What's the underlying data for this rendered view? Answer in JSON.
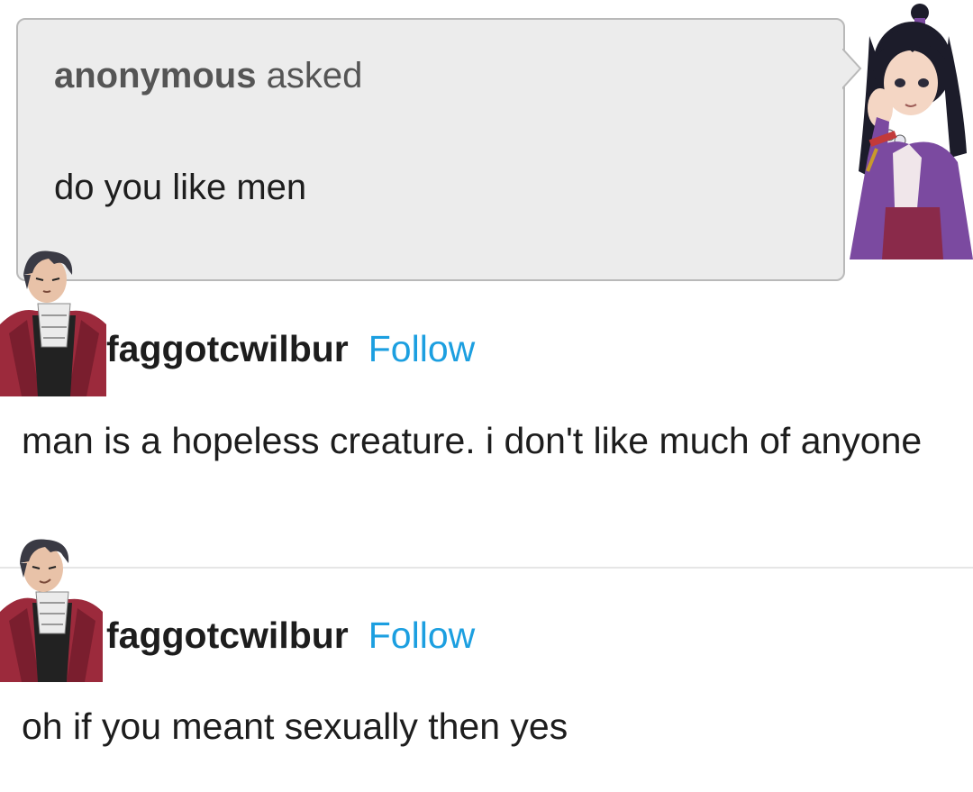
{
  "ask": {
    "asker": "anonymous",
    "asked_label": "asked",
    "question": "do you like men"
  },
  "posts": [
    {
      "username": "faggotcwilbur",
      "follow_label": "Follow",
      "text": "man is a hopeless creature. i don't like much of anyone"
    },
    {
      "username": "faggotcwilbur",
      "follow_label": "Follow",
      "text": "oh if you meant sexually then yes"
    }
  ],
  "colors": {
    "follow": "#1c9fe0",
    "ask_background": "#ececec",
    "coat": "#9c2a3c",
    "robe": "#7b4aa0"
  },
  "icons": {
    "asker_avatar": "purple-robed-girl-avatar",
    "poster_avatar": "red-suit-man-avatar"
  }
}
